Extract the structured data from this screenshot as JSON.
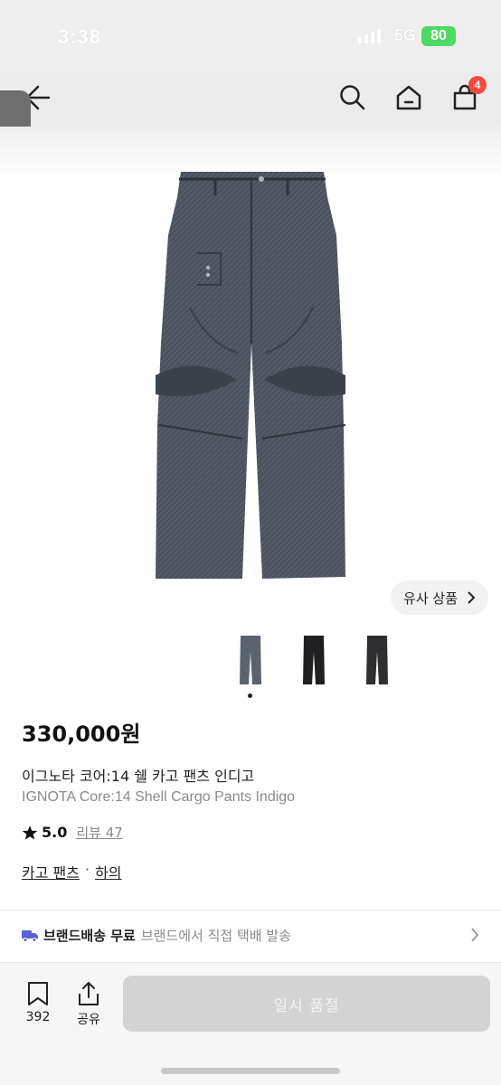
{
  "status_bar": {
    "time": "3:38",
    "network": "5G",
    "battery": "80"
  },
  "header": {
    "cart_count": "4"
  },
  "product": {
    "similar_label": "유사 상품",
    "price": "330,000원",
    "name_ko": "이그노타 코어:14 쉘 카고 팬츠 인디고",
    "name_en": "IGNOTA Core:14 Shell Cargo Pants Indigo",
    "rating": "5.0",
    "review_label": "리뷰 47",
    "categories": [
      "카고 팬츠",
      "하의"
    ],
    "category_separator": "·",
    "thumbnail_colors": [
      "#5b636e",
      "#1f1f21",
      "#2f2f31"
    ]
  },
  "shipping": {
    "tag": "브랜드배송 무료",
    "detail": "브랜드에서 직접 택배 발송"
  },
  "bottom_bar": {
    "like_count": "392",
    "share_label": "공유",
    "soldout_label": "일시 품절"
  },
  "colors": {
    "accent_badge": "#f24a3d",
    "denim": "#4a515c",
    "battery": "#4cd964"
  }
}
